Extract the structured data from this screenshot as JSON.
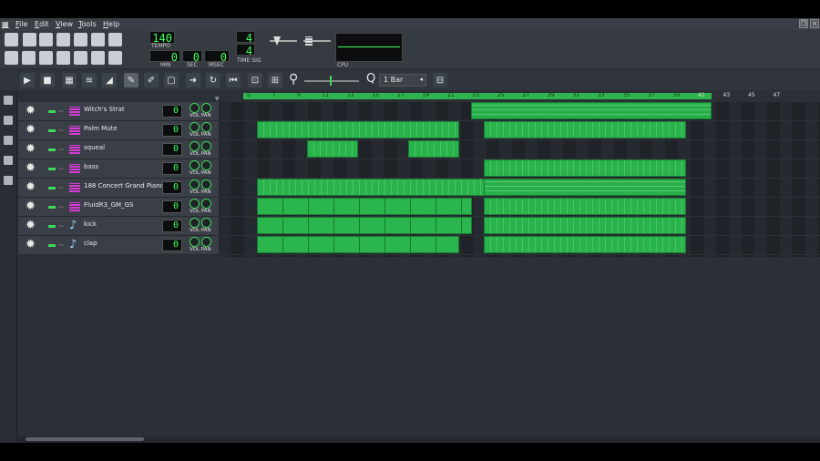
{
  "menu": {
    "items": [
      "File",
      "Edit",
      "View",
      "Tools",
      "Help"
    ]
  },
  "transport": {
    "tempo_value": "140",
    "tempo_label": "TEMPO",
    "min_value": "0",
    "min_label": "MIN",
    "sec_value": "0",
    "sec_label": "SEC",
    "msec_value": "0",
    "msec_label": "MSEC",
    "timesig_num": "4",
    "timesig_den": "4",
    "timesig_label": "TIME SIG",
    "cpu_label": "CPU"
  },
  "song_toolbar": {
    "zoom_value": "1 Bar"
  },
  "ruler": {
    "ticks": [
      "5",
      "7",
      "9",
      "11",
      "13",
      "15",
      "17",
      "19",
      "21",
      "23",
      "25",
      "27",
      "29",
      "31",
      "33",
      "35",
      "37",
      "39",
      "41",
      "43",
      "45",
      "47"
    ]
  },
  "tracks": [
    {
      "name": "Witch's Strat",
      "type": "synth",
      "vol": "0",
      "vp_label": "VOL PAN"
    },
    {
      "name": "Palm Mute",
      "type": "synth",
      "vol": "0",
      "vp_label": "VOL PAN"
    },
    {
      "name": "squeal",
      "type": "synth",
      "vol": "0",
      "vp_label": "VOL PAN"
    },
    {
      "name": "bass",
      "type": "synth",
      "vol": "0",
      "vp_label": "VOL PAN"
    },
    {
      "name": "188 Concert Grand Piano",
      "type": "synth",
      "vol": "0",
      "vp_label": "VOL PAN"
    },
    {
      "name": "FluidR3_GM_GS",
      "type": "synth",
      "vol": "0",
      "vp_label": "VOL PAN"
    },
    {
      "name": "kick",
      "type": "sample",
      "vol": "0",
      "vp_label": "VOL PAN"
    },
    {
      "name": "clap",
      "type": "sample",
      "vol": "0",
      "vp_label": "VOL PAN"
    }
  ],
  "colors": {
    "accent": "#27b04a",
    "lcd_text": "#3dff5c",
    "synth_icon": "#d63bd6",
    "background": "#2b2f36"
  },
  "icons": {
    "toolbar1": [
      "new-icon",
      "new-from-template-icon",
      "open-icon",
      "recent-icon",
      "save-icon",
      "export-icon",
      "export-tracks-icon",
      "song-editor-icon",
      "beat-bass-icon",
      "piano-roll-icon",
      "automation-icon",
      "mixer-icon",
      "controller-icon",
      "project-notes-icon"
    ],
    "toolbar2": [
      "play-icon",
      "stop-icon",
      "add-beat-track-icon",
      "add-sample-track-icon",
      "add-automation-track-icon",
      "draw-mode-icon",
      "edit-mode-icon",
      "select-mode-icon",
      "auto-scroll-icon",
      "loop-points-icon",
      "stop-behaviour-icon",
      "fit-icon",
      "fit-all-icon",
      "zoom-icon",
      "quantize-icon",
      "proportional-snap-icon"
    ],
    "sidebar": [
      "instrument-plugins-icon",
      "projects-icon",
      "samples-icon",
      "presets-icon",
      "home-icon",
      "computer-icon"
    ]
  }
}
